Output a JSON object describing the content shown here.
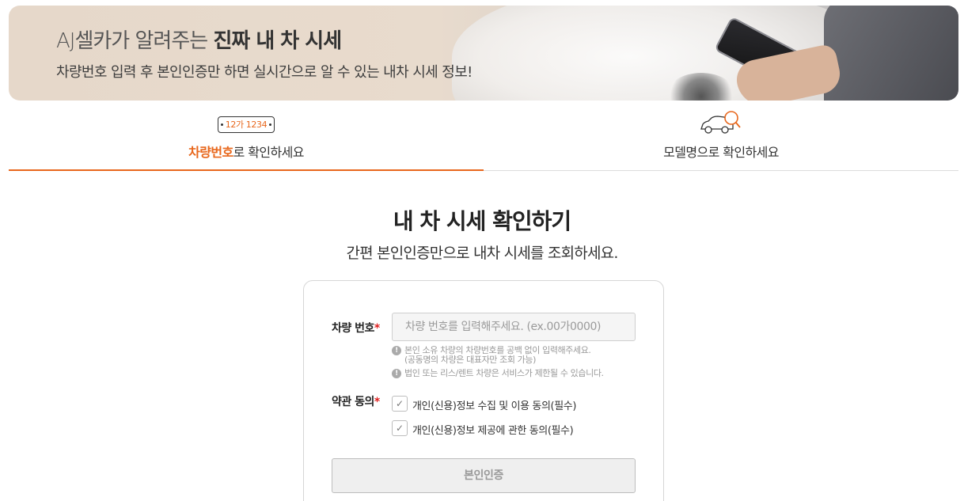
{
  "banner": {
    "brand_prefix": "AJ셀카가 알려주는 ",
    "brand_bold": "진짜 내 차 시세",
    "subtitle": "차량번호 입력 후 본인인증만 하면 실시간으로 알 수 있는 내차 시세 정보!"
  },
  "tabs": [
    {
      "plate_text": "12가 1234",
      "label_highlight": "차량번호",
      "label_rest": "로 확인하세요",
      "active": true
    },
    {
      "icon": "car-search-icon",
      "label": "모델명으로 확인하세요",
      "active": false
    }
  ],
  "main": {
    "title": "내 차 시세 확인하기",
    "subtitle": "간편 본인인증만으로 내차 시세를 조회하세요."
  },
  "form": {
    "car_number_label": "차량 번호",
    "required_mark": "*",
    "car_number_placeholder": "차량 번호를 입력해주세요. (ex.00가0000)",
    "car_number_value": "",
    "notes": [
      "본인 소유 차량의 차량번호를 공백 없이 입력해주세요.",
      "(공동명의 차량은 대표자만 조회 가능)",
      "법인 또는 리스/렌트 차량은 서비스가 제한될 수 있습니다."
    ],
    "terms_label": "약관 동의",
    "agreements": [
      {
        "label": "개인(신용)정보 수집 및 이용 동의(필수)",
        "checked": false
      },
      {
        "label": "개인(신용)정보 제공에 관한 동의(필수)",
        "checked": false
      }
    ],
    "checkmark": "✓",
    "info_glyph": "!",
    "verify_button": "본인인증"
  },
  "colors": {
    "accent": "#e8671c",
    "required": "#e02020"
  }
}
